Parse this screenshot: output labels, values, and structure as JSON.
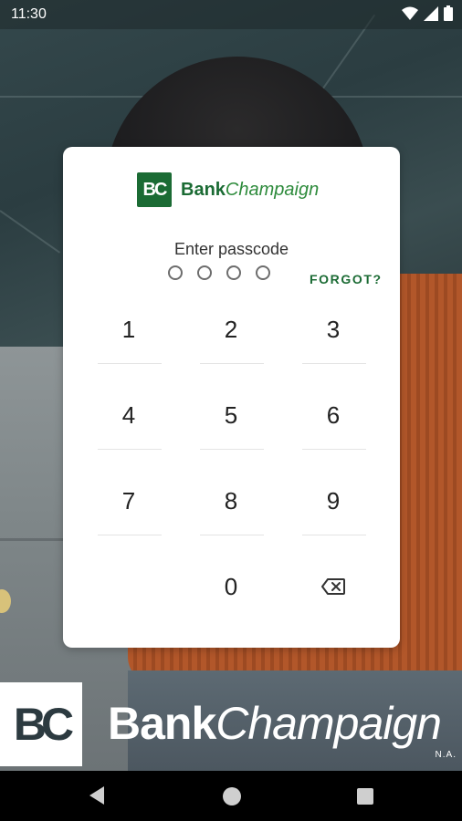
{
  "status_bar": {
    "time": "11:30",
    "icons": [
      "wifi-icon",
      "signal-icon",
      "battery-icon"
    ]
  },
  "card": {
    "logo_mark": "BC",
    "logo_bank": "Bank",
    "logo_champaign": "Champaign",
    "prompt": "Enter passcode",
    "dot_count": 4,
    "forgot": "FORGOT?",
    "keys": [
      "1",
      "2",
      "3",
      "4",
      "5",
      "6",
      "7",
      "8",
      "9",
      "0"
    ],
    "backspace_icon": "backspace-icon"
  },
  "banner": {
    "mark": "BC",
    "bank": "Bank",
    "champaign": "Champaign",
    "suffix": "N.A."
  },
  "nav_bar": {
    "icons": [
      "back-icon",
      "home-icon",
      "recents-icon"
    ]
  },
  "colors": {
    "brand_green": "#1b6b34",
    "brand_light_green": "#2e8b3c",
    "card_background": "#ffffff",
    "nav_background": "#000000"
  }
}
